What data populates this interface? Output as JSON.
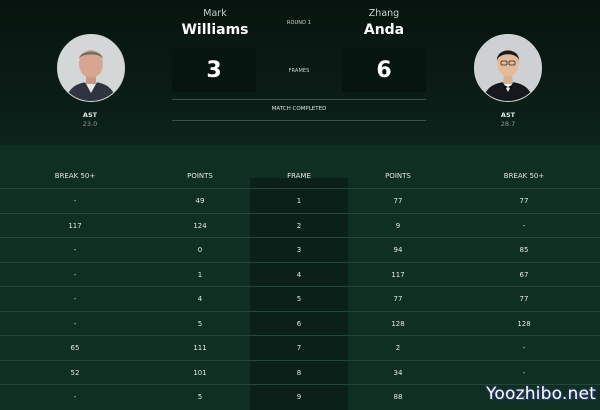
{
  "match": {
    "round": "ROUND 1",
    "frames_label": "FRAMES",
    "status": "MATCH COMPLETED"
  },
  "player1": {
    "first_name": "Mark",
    "last_name": "Williams",
    "score": "3",
    "stat_label": "AST",
    "stat_value": "23.0"
  },
  "player2": {
    "first_name": "Zhang",
    "last_name": "Anda",
    "score": "6",
    "stat_label": "AST",
    "stat_value": "28.7"
  },
  "table": {
    "headers": [
      "BREAK 50+",
      "POINTS",
      "FRAME",
      "POINTS",
      "BREAK 50+"
    ],
    "rows": [
      [
        "-",
        "49",
        "1",
        "77",
        "77"
      ],
      [
        "117",
        "124",
        "2",
        "9",
        "-"
      ],
      [
        "-",
        "0",
        "3",
        "94",
        "85"
      ],
      [
        "-",
        "1",
        "4",
        "117",
        "67"
      ],
      [
        "-",
        "4",
        "5",
        "77",
        "77"
      ],
      [
        "-",
        "5",
        "6",
        "128",
        "128"
      ],
      [
        "65",
        "111",
        "7",
        "2",
        "-"
      ],
      [
        "52",
        "101",
        "8",
        "34",
        "-"
      ],
      [
        "-",
        "5",
        "9",
        "88",
        "-"
      ]
    ]
  },
  "watermark": "Yoozhibo.net",
  "colors": {
    "background": "#0d2a20",
    "header_background": "#07140f",
    "score_box": "#061510",
    "frame_column": "#0a2019"
  }
}
